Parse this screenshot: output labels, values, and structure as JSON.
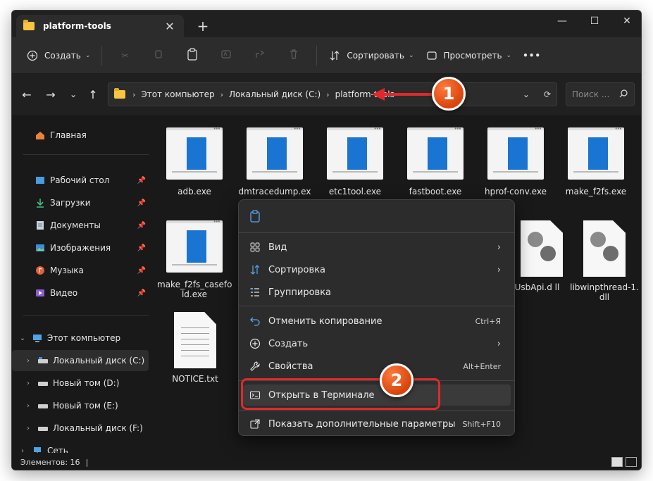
{
  "window": {
    "tab_title": "platform-tools",
    "close_tab": "✕",
    "new_tab": "+",
    "minimize": "—",
    "maximize": "☐",
    "close": "✕"
  },
  "toolbar": {
    "create_label": "Создать",
    "sort_label": "Сортировать",
    "view_label": "Просмотреть",
    "more_label": "•••"
  },
  "address": {
    "crumbs": [
      "Этот компьютер",
      "Локальный диск (C:)",
      "platform-tools"
    ],
    "search_placeholder": "Поиск ..."
  },
  "sidebar": {
    "home": "Главная",
    "quick": [
      "Рабочий стол",
      "Загрузки",
      "Документы",
      "Изображения",
      "Музыка",
      "Видео"
    ],
    "this_pc": "Этот компьютер",
    "drives": [
      "Локальный диск (C:)",
      "Новый том (D:)",
      "Новый том (E:)",
      "Локальный диск (F:)"
    ],
    "network": "Сеть"
  },
  "files": {
    "row1": [
      "adb.exe",
      "dmtracedump.ex",
      "etc1tool.exe",
      "fastboot.exe",
      "hprof-conv.exe",
      "make_f2fs.exe"
    ],
    "make_f2fs_casefold": "make_f2fs_casefo ld.exe",
    "adbwinusb": "nUsbApi.d ll",
    "libwinpthread": "libwinpthread-1. dll",
    "notice": "NOTICE.txt"
  },
  "context_menu": {
    "items": [
      {
        "label": "Вид",
        "shortcut": "",
        "submenu": true
      },
      {
        "label": "Сортировка",
        "shortcut": "",
        "submenu": true
      },
      {
        "label": "Группировка",
        "shortcut": "",
        "submenu": true
      },
      {
        "label": "Отменить копирование",
        "shortcut": "Ctrl+Я",
        "submenu": false
      },
      {
        "label": "Создать",
        "shortcut": "",
        "submenu": true
      },
      {
        "label": "Свойства",
        "shortcut": "Alt+Enter",
        "submenu": false
      },
      {
        "label": "Открыть в Терминале",
        "shortcut": "",
        "submenu": false
      },
      {
        "label": "Показать дополнительные параметры",
        "shortcut": "Shift+F10",
        "submenu": false
      }
    ]
  },
  "status": {
    "items_count": "Элементов: 16"
  },
  "annotations": {
    "badge1": "1",
    "badge2": "2"
  },
  "colors": {
    "accent_red": "#e0292b",
    "badge_orange": "#d8440c",
    "folder_yellow": "#f7c443",
    "exe_blue": "#1a74d2"
  }
}
